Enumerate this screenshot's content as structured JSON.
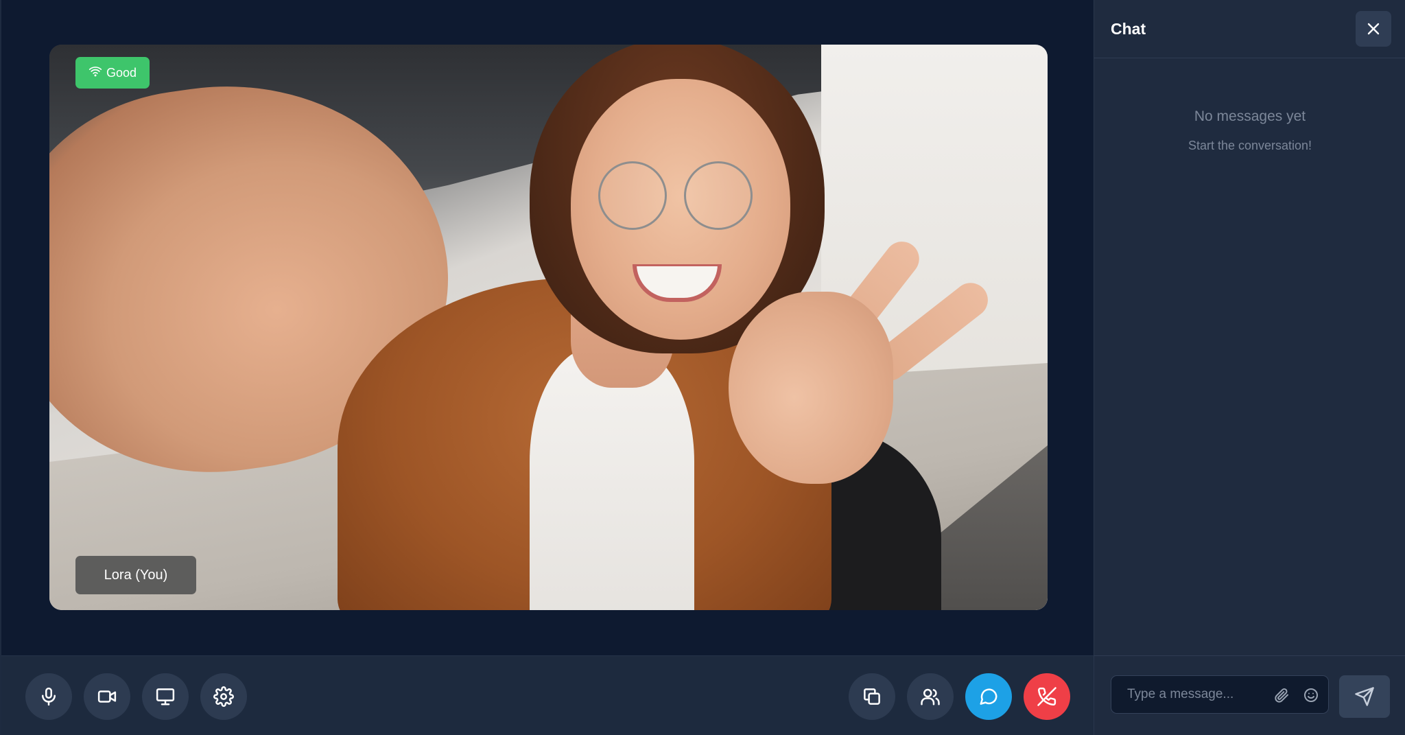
{
  "video": {
    "connection_status": "Good",
    "participant_name": "Lora (You)"
  },
  "toolbar": {
    "left_buttons": [
      "microphone-icon",
      "video-camera-icon",
      "screen-share-icon",
      "settings-icon"
    ],
    "right_buttons": [
      "copy-icon",
      "participants-icon",
      "chat-icon",
      "end-call-icon"
    ],
    "colors": {
      "chat_button": "#1da1e6",
      "end_call_button": "#ef3f47",
      "status_good": "#3ec56b"
    }
  },
  "chat": {
    "title": "Chat",
    "empty_title": "No messages yet",
    "empty_subtitle": "Start the conversation!",
    "input_placeholder": "Type a message..."
  }
}
